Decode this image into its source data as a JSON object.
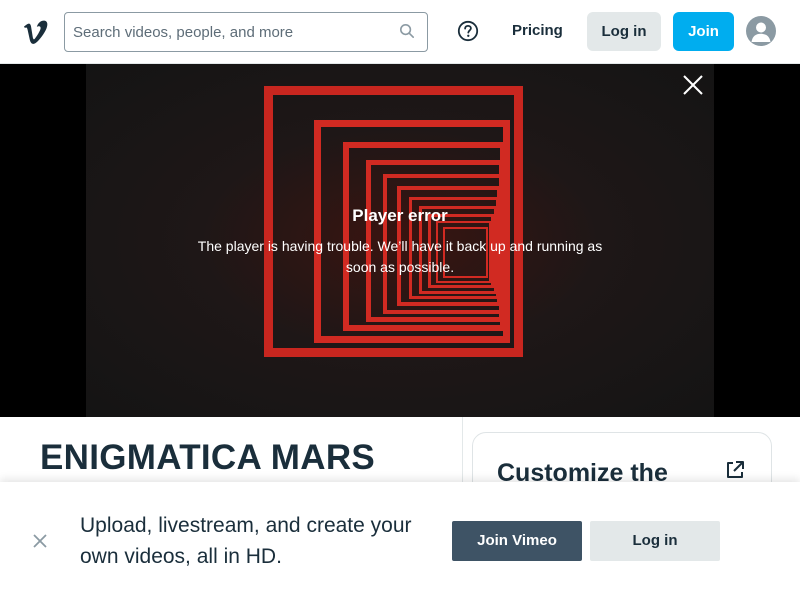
{
  "colors": {
    "brand": "#1a2e3b",
    "join_accent": "#00adef",
    "secondary_button": "#e3e8e9",
    "join_vimeo_button": "#3e5365",
    "art_red": "#d12a22"
  },
  "header": {
    "logo_icon": "vimeo-v-logo",
    "search": {
      "placeholder": "Search videos, people, and more",
      "value": "",
      "icon": "search-icon"
    },
    "help_icon": "question-circle-icon",
    "pricing_label": "Pricing",
    "login_label": "Log in",
    "join_label": "Join",
    "avatar_icon": "user-avatar-icon"
  },
  "player": {
    "close_icon": "close-icon",
    "error_title": "Player error",
    "error_message": "The player is having trouble. We’ll have it back up and running as soon as possible."
  },
  "video": {
    "title": "ENIGMATICA MARS"
  },
  "side_card": {
    "title": "Customize the",
    "icon": "external-link-icon"
  },
  "banner": {
    "close_icon": "close-icon",
    "text": "Upload, livestream, and create your own videos, all in HD.",
    "join_label": "Join Vimeo",
    "login_label": "Log in"
  }
}
